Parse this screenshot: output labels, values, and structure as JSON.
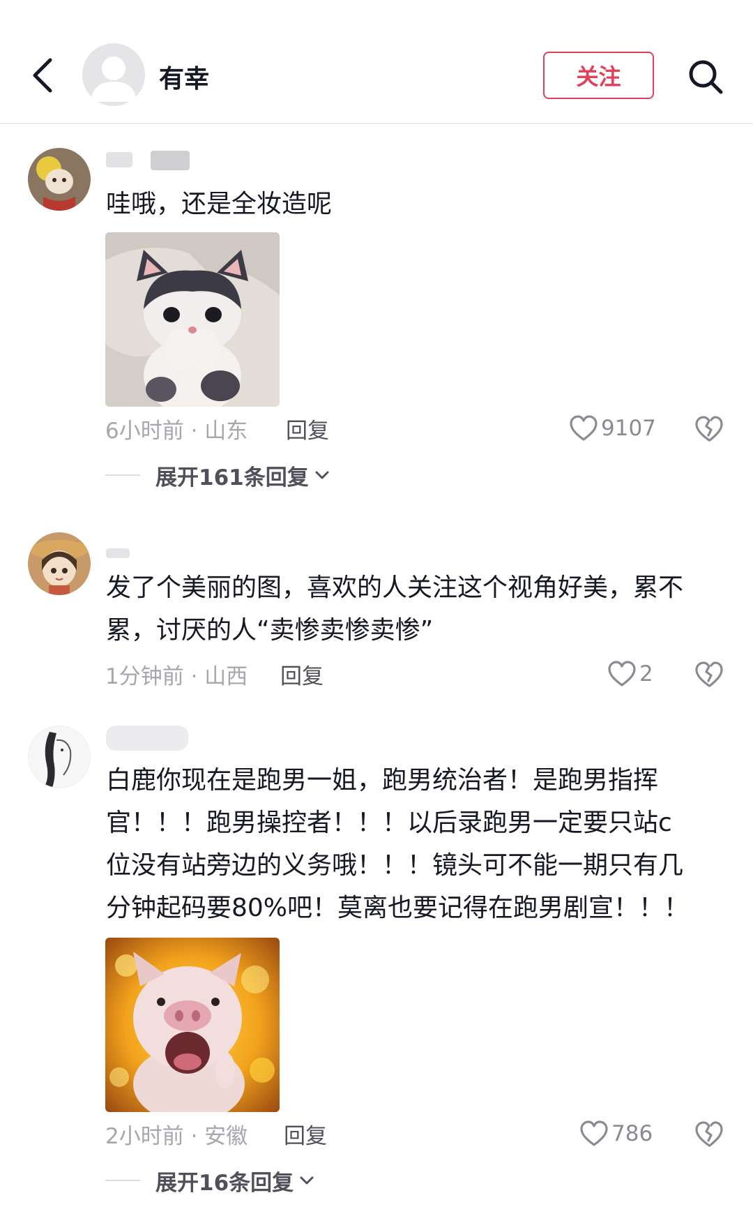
{
  "header": {
    "title": "有幸",
    "follow_label": "关注"
  },
  "comments": [
    {
      "text": "哇哦，还是全妆造呢",
      "time_location": "6小时前 · 山东",
      "reply_label": "回复",
      "likes": "9107",
      "expand_label": "展开161条回复",
      "image": "kitten-sticker"
    },
    {
      "text_lines": [
        "发了个美丽的图，喜欢的人关注这个视角好美，累不",
        "累，讨厌的人“卖惨卖惨卖惨”"
      ],
      "time_location": "1分钟前 · 山西",
      "reply_label": "回复",
      "likes": "2"
    },
    {
      "text_lines": [
        "白鹿你现在是跑男一姐，跑男统治者！是跑男指挥",
        "官！！！跑男操控者！！！以后录跑男一定要只站c",
        "位没有站旁边的义务哦！！！镜头可不能一期只有几",
        "分钟起码要80%吧！莫离也要记得在跑男剧宣！！！"
      ],
      "time_location": "2小时前 · 安徽",
      "reply_label": "回复",
      "likes": "786",
      "expand_label": "展开16条回复",
      "image": "screaming-pig-sticker"
    }
  ],
  "colors": {
    "accent": "#e0405a",
    "text_primary": "#161823",
    "text_secondary": "#a6a6ad"
  }
}
